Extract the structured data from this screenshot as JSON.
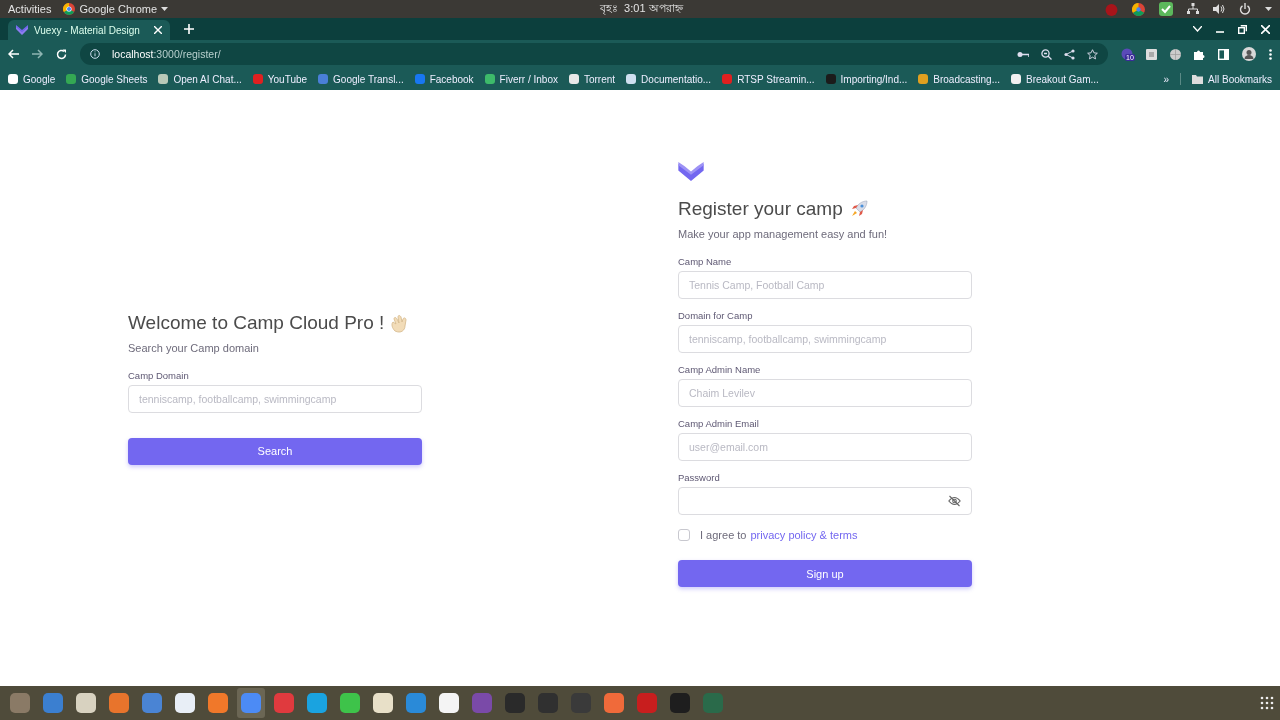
{
  "top_bar": {
    "activities": "Activities",
    "app_menu": "Google Chrome",
    "day": "বৃহঃ",
    "time": "3:01 অপরাহ্ন"
  },
  "tabs": [
    {
      "title": "Vuexy - Material Design",
      "selected": true
    }
  ],
  "address_bar": {
    "url_host": "localhost",
    "url_path": ":3000/register/"
  },
  "extension_badge": "10",
  "bookmarks": [
    {
      "label": "Google",
      "color": "#ffffff"
    },
    {
      "label": "Google Sheets",
      "color": "#34a853"
    },
    {
      "label": "Open AI Chat...",
      "color": "#b8c9b8"
    },
    {
      "label": "YouTube",
      "color": "#e02020"
    },
    {
      "label": "Google Transl...",
      "color": "#4a7fd8"
    },
    {
      "label": "Facebook",
      "color": "#1877f2"
    },
    {
      "label": "Fiverr / Inbox",
      "color": "#3dbb6a"
    },
    {
      "label": "Torrent",
      "color": "#e8e8e8"
    },
    {
      "label": "Documentatio...",
      "color": "#cfe0f0"
    },
    {
      "label": "RTSP Streamin...",
      "color": "#e02020"
    },
    {
      "label": "Importing/Ind...",
      "color": "#1b1b1b"
    },
    {
      "label": "Broadcasting...",
      "color": "#e0a020"
    },
    {
      "label": "Breakout Gam...",
      "color": "#f0f0f0"
    }
  ],
  "bookmarks_overflow": "»",
  "all_bookmarks": "All Bookmarks",
  "search_panel": {
    "title": "Welcome to Camp Cloud Pro !",
    "subtitle": "Search your Camp domain",
    "field_label": "Camp Domain",
    "placeholder": "tenniscamp, footballcamp, swimmingcamp",
    "button": "Search"
  },
  "register_panel": {
    "title": "Register your camp",
    "subtitle": "Make your app management easy and fun!",
    "fields": [
      {
        "label": "Camp Name",
        "placeholder": "Tennis Camp, Football Camp",
        "kind": "text"
      },
      {
        "label": "Domain for Camp",
        "placeholder": "tenniscamp, footballcamp, swimmingcamp",
        "kind": "text"
      },
      {
        "label": "Camp Admin Name",
        "placeholder": "Chaim Levilev",
        "kind": "text"
      },
      {
        "label": "Camp Admin Email",
        "placeholder": "user@email.com",
        "kind": "text"
      },
      {
        "label": "Password",
        "kind": "password"
      }
    ],
    "agree": {
      "text": "I agree to",
      "link": "privacy policy & terms",
      "checked": false
    },
    "button": "Sign up"
  },
  "dock": [
    {
      "color": "#8a7a66",
      "selected": false
    },
    {
      "color": "#3b7fd0",
      "selected": false
    },
    {
      "color": "#d8d2c0",
      "selected": false
    },
    {
      "color": "#e8742c",
      "selected": false
    },
    {
      "color": "#4a84d4",
      "selected": false
    },
    {
      "color": "#e8eef6",
      "selected": false
    },
    {
      "color": "#f0782a",
      "selected": false
    },
    {
      "color": "#4c8bf5",
      "selected": true
    },
    {
      "color": "#e03a3e",
      "selected": false
    },
    {
      "color": "#1aa3e0",
      "selected": false
    },
    {
      "color": "#3ec34a",
      "selected": false
    },
    {
      "color": "#e8e0c8",
      "selected": false
    },
    {
      "color": "#2a8ad8",
      "selected": false
    },
    {
      "color": "#f4f4f4",
      "selected": false
    },
    {
      "color": "#7a4aa8",
      "selected": false
    },
    {
      "color": "#2a2a2a",
      "selected": false
    },
    {
      "color": "#303030",
      "selected": false
    },
    {
      "color": "#3a3a3a",
      "selected": false
    },
    {
      "color": "#f06a3a",
      "selected": false
    },
    {
      "color": "#c81e1e",
      "selected": false
    },
    {
      "color": "#1e1e1e",
      "selected": false
    },
    {
      "color": "#2a6a4a",
      "selected": false
    }
  ]
}
